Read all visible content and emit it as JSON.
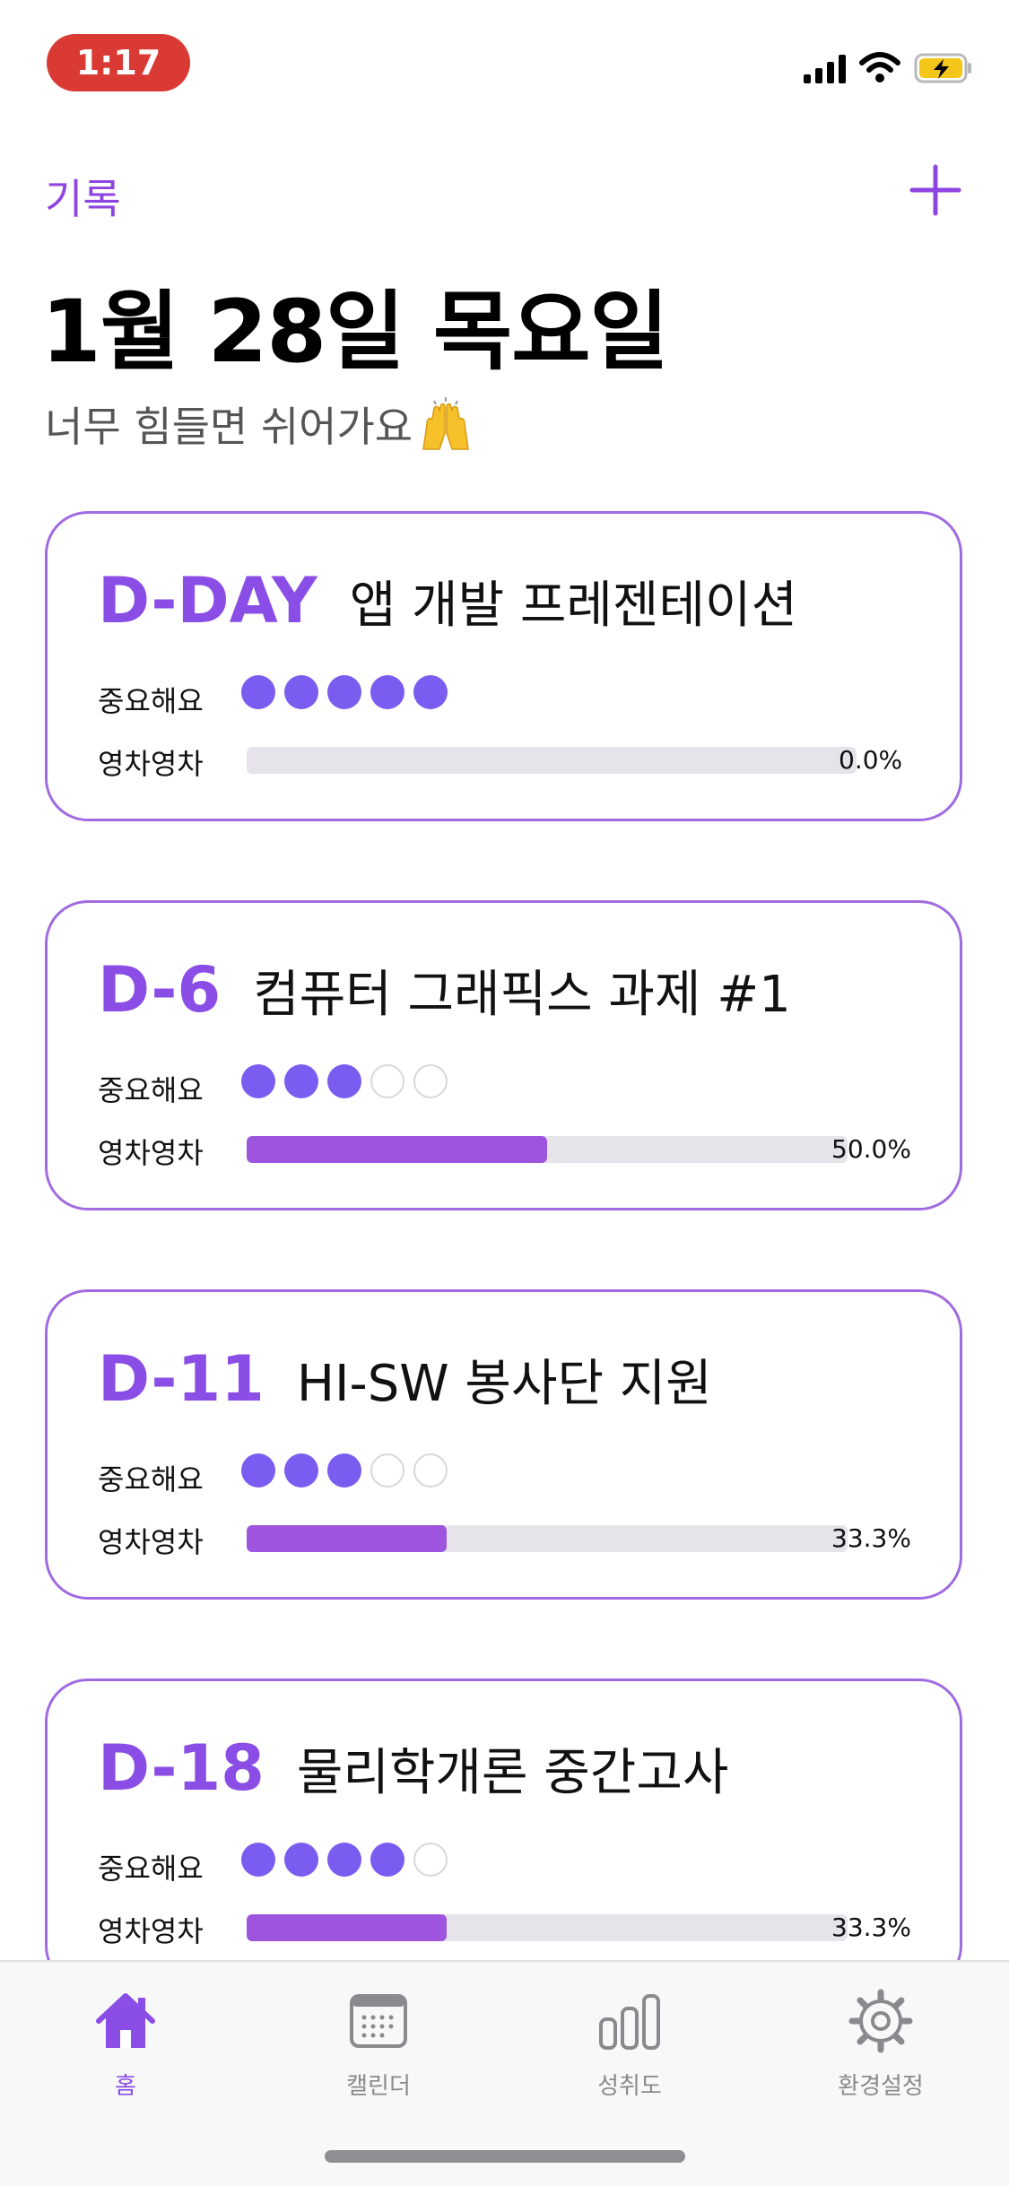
{
  "status": {
    "time": "1:17"
  },
  "header": {
    "back_label": "기록",
    "title": "1월 28일 목요일",
    "subtitle": "너무 힘들면 쉬어가요"
  },
  "labels": {
    "importance": "중요해요",
    "progress": "영차영차"
  },
  "colors": {
    "accent": "#8a4de6",
    "dot": "#7a5cf0",
    "bar": "#9d55e0",
    "card_border": "#a06be0"
  },
  "tasks": [
    {
      "dday": "D-DAY",
      "title": "앱 개발 프레젠테이션",
      "importance": 5,
      "progress": 0.0,
      "progress_text": "0.0%"
    },
    {
      "dday": "D-6",
      "title": "컴퓨터 그래픽스 과제 #1",
      "importance": 3,
      "progress": 0.5,
      "progress_text": "50.0%"
    },
    {
      "dday": "D-11",
      "title": "HI-SW 봉사단 지원",
      "importance": 3,
      "progress": 0.333,
      "progress_text": "33.3%"
    },
    {
      "dday": "D-18",
      "title": "물리학개론 중간고사",
      "importance": 4,
      "progress": 0.333,
      "progress_text": "33.3%"
    }
  ],
  "tabbar": {
    "items": [
      {
        "label": "홈",
        "icon": "home-icon",
        "active": true
      },
      {
        "label": "캘린더",
        "icon": "calendar-icon",
        "active": false
      },
      {
        "label": "성취도",
        "icon": "bar-chart-icon",
        "active": false
      },
      {
        "label": "환경설정",
        "icon": "gear-icon",
        "active": false
      }
    ]
  }
}
